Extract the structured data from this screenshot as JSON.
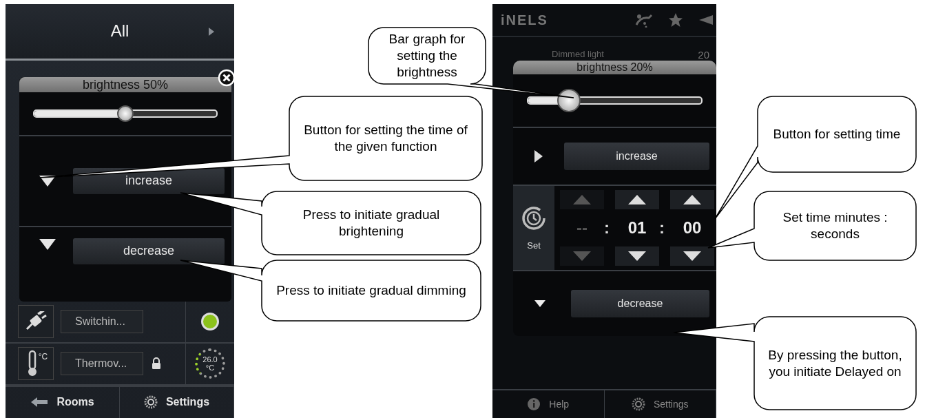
{
  "left_phone": {
    "header": {
      "title": "All"
    },
    "popup": {
      "title": "brightness 50%",
      "level": 0.5,
      "buttons": [
        {
          "label": "increase"
        },
        {
          "label": "decrease"
        }
      ]
    },
    "rows": [
      {
        "kind": "switch",
        "label": "Switchin...",
        "on": true
      },
      {
        "kind": "thermostat",
        "icon_label": "°C",
        "label": "Thermov...",
        "locked": true,
        "reading": "26.0",
        "unit": "°C"
      }
    ],
    "bottom_bar": [
      {
        "kind": "back",
        "label": "Rooms"
      },
      {
        "kind": "settings",
        "label": "Settings"
      }
    ]
  },
  "right_phone": {
    "logo": "iNELS",
    "background_row": {
      "label": "Dimmed light",
      "value": "20"
    },
    "popup": {
      "title": "brightness 20%",
      "level": 0.2,
      "buttons": [
        {
          "label": "increase"
        },
        {
          "label": "decrease"
        }
      ],
      "timer": {
        "label": "Set",
        "fields": [
          {
            "value": "--",
            "disabled": true
          },
          {
            "value": "01",
            "disabled": false
          },
          {
            "value": "00",
            "disabled": false
          }
        ],
        "separators": [
          ":",
          ":"
        ]
      }
    },
    "bottom_bar": [
      {
        "kind": "help",
        "label": "Help"
      },
      {
        "kind": "settings",
        "label": "Settings"
      }
    ]
  },
  "callouts": [
    {
      "text": "Bar graph for setting the brightness"
    },
    {
      "text": "Button for setting the time of the given function"
    },
    {
      "text": "Press to initiate gradual brightening"
    },
    {
      "text": "Press to initiate gradual dimming"
    },
    {
      "text": "Button for setting time"
    },
    {
      "text": "Set time minutes : seconds"
    },
    {
      "text": "By pressing the button, you initiate Delayed on"
    }
  ]
}
